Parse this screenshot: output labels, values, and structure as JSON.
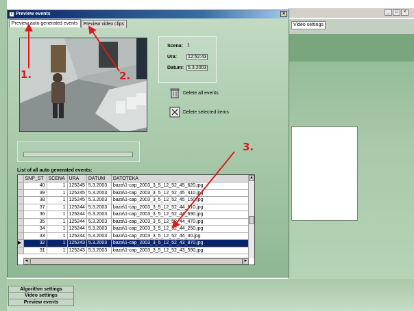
{
  "dialog": {
    "title": "Preview events",
    "tabs": [
      {
        "label": "Preview auto generated events",
        "active": true
      },
      {
        "label": "Preview video clips",
        "active": false
      }
    ]
  },
  "info": {
    "scene_label": "Scena:",
    "scene_value": "1",
    "time_label": "Ura:",
    "time_value": "12:52:43",
    "date_label": "Datum:",
    "date_value": "5.3.2003"
  },
  "actions": {
    "delete_all": "Delete all events",
    "delete_selected": "Delete selected items"
  },
  "progress": {
    "fraction": 0.0
  },
  "list": {
    "caption": "List of all auto generated events:",
    "columns": [
      "SNP_ST",
      "SCENA",
      "URA",
      "DATUM",
      "DATOTEKA"
    ],
    "rows": [
      {
        "snp": "40",
        "scena": "1",
        "ura": "125245",
        "datum": "5.3.2003",
        "file": "baza\\1-cap_2003_3_5_12_52_45_620.jpg"
      },
      {
        "snp": "39",
        "scena": "1",
        "ura": "125245",
        "datum": "5.3.2003",
        "file": "baza\\1-cap_2003_3_5_12_52_45_410.jpg"
      },
      {
        "snp": "38",
        "scena": "1",
        "ura": "125245",
        "datum": "5.3.2003",
        "file": "baza\\1-cap_2003_3_5_12_52_45_150.jpg"
      },
      {
        "snp": "37",
        "scena": "1",
        "ura": "125244",
        "datum": "5.3.2003",
        "file": "baza\\1-cap_2003_3_5_12_52_44_910.jpg"
      },
      {
        "snp": "36",
        "scena": "1",
        "ura": "125244",
        "datum": "5.3.2003",
        "file": "baza\\1-cap_2003_3_5_12_52_44_690.jpg"
      },
      {
        "snp": "35",
        "scena": "1",
        "ura": "125244",
        "datum": "5.3.2003",
        "file": "baza\\1-cap_2003_3_5_12_52_44_470.jpg"
      },
      {
        "snp": "34",
        "scena": "1",
        "ura": "125244",
        "datum": "5.3.2003",
        "file": "baza\\1-cap_2003_3_5_12_52_44_250.jpg"
      },
      {
        "snp": "33",
        "scena": "1",
        "ura": "125244",
        "datum": "5.3.2003",
        "file": "baza\\1-cap_2003_3_5_12_52_44_30.jpg"
      },
      {
        "snp": "32",
        "scena": "1",
        "ura": "125243",
        "datum": "5.3.2003",
        "file": "baza\\1-cap_2003_3_5_12_52_43_870.jpg",
        "selected": true
      },
      {
        "snp": "31",
        "scena": "1",
        "ura": "125243",
        "datum": "5.3.2003",
        "file": "baza\\1-cap_2003_3_5_12_52_43_590.jpg"
      }
    ]
  },
  "background": {
    "video_settings_tab": "Video settings",
    "side_tabs": [
      "Algorithm settings",
      "Video settings",
      "Preview events"
    ]
  },
  "annotations": {
    "marks": [
      "1.",
      "2.",
      "3."
    ],
    "color": "#e01a1a"
  },
  "colors": {
    "dialog_green": "#a6c8a8",
    "titlebar": "#0a246a",
    "selection": "#0a246a"
  },
  "icons": {
    "delete_all": "trash-icon",
    "delete_selected": "delete-selected-icon"
  }
}
